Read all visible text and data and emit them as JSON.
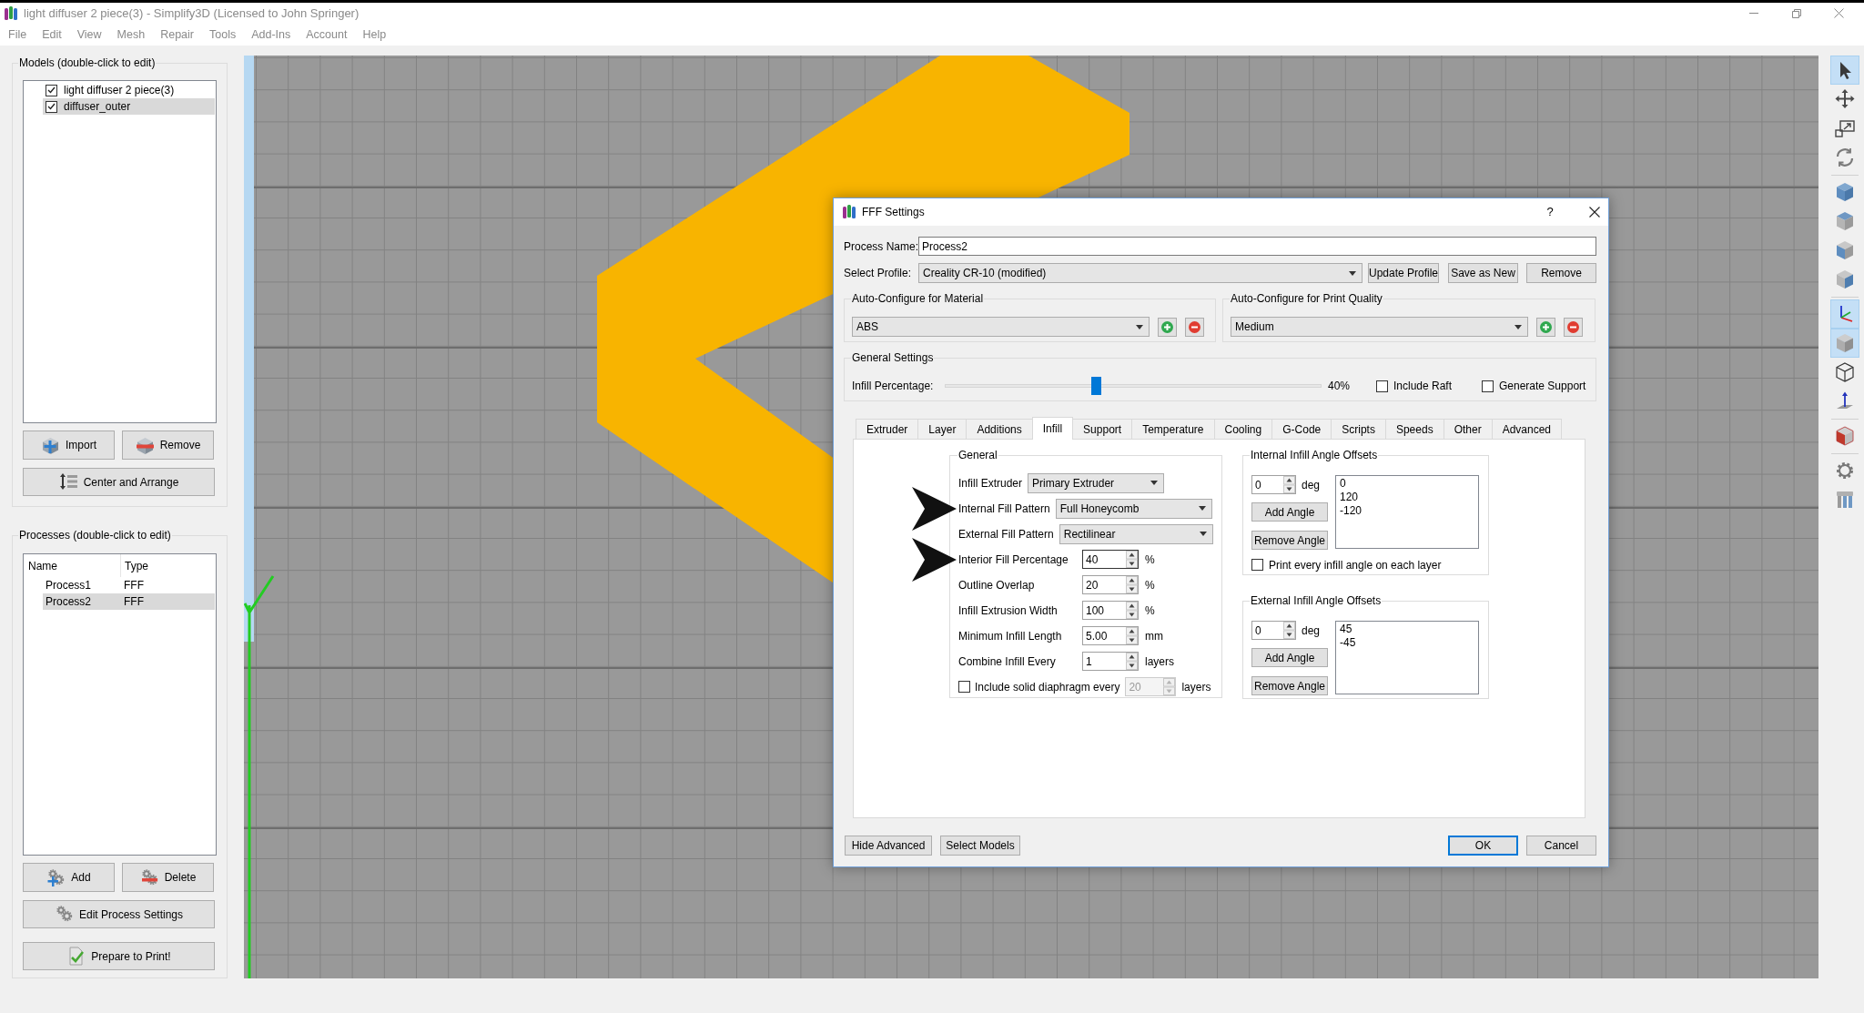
{
  "window": {
    "title": "light diffuser 2 piece(3) - Simplify3D (Licensed to John Springer)"
  },
  "menu": [
    "File",
    "Edit",
    "View",
    "Mesh",
    "Repair",
    "Tools",
    "Add-Ins",
    "Account",
    "Help"
  ],
  "models_panel": {
    "title": "Models (double-click to edit)",
    "items": [
      {
        "name": "light diffuser 2 piece(3)",
        "checked": true,
        "selected": false
      },
      {
        "name": "diffuser_outer",
        "checked": true,
        "selected": true
      }
    ],
    "buttons": [
      "Import",
      "Remove",
      "Center and Arrange"
    ]
  },
  "processes_panel": {
    "title": "Processes (double-click to edit)",
    "columns": [
      "Name",
      "Type"
    ],
    "rows": [
      {
        "name": "Process1",
        "type": "FFF",
        "selected": false
      },
      {
        "name": "Process2",
        "type": "FFF",
        "selected": true
      }
    ],
    "buttons": [
      "Add",
      "Delete",
      "Edit Process Settings",
      "Prepare to Print!"
    ]
  },
  "toolbar": [
    {
      "selected": true
    },
    {
      "selected": false
    },
    {
      "selected": false
    },
    {
      "selected": false
    },
    {
      "selected": false
    },
    {
      "selected": false
    },
    {
      "selected": false
    },
    {
      "selected": false
    },
    {
      "selected": true
    },
    {
      "selected": true
    },
    {
      "selected": false
    },
    {
      "selected": false
    },
    {
      "selected": false
    },
    {
      "selected": false
    },
    {
      "selected": false
    }
  ],
  "dialog": {
    "title": "FFF Settings",
    "help": "?",
    "process_name": {
      "label": "Process Name:",
      "value": "Process2"
    },
    "profile": {
      "label": "Select Profile:",
      "value": "Creality CR-10 (modified)",
      "buttons": [
        "Update Profile",
        "Save as New",
        "Remove"
      ]
    },
    "auto_configure": [
      {
        "title": "Auto-Configure for Material",
        "value": "ABS"
      },
      {
        "title": "Auto-Configure for Print Quality",
        "value": "Medium"
      }
    ],
    "general": {
      "title": "General Settings",
      "infill": {
        "label": "Infill Percentage:",
        "level": 0.4,
        "reading": "40%"
      },
      "checkboxes": [
        {
          "label": "Include Raft",
          "checked": false
        },
        {
          "label": "Generate Support",
          "checked": false
        }
      ]
    },
    "tabs": [
      {
        "label": "Extruder",
        "selected": false
      },
      {
        "label": "Layer",
        "selected": false
      },
      {
        "label": "Additions",
        "selected": false
      },
      {
        "label": "Infill",
        "selected": true
      },
      {
        "label": "Support",
        "selected": false
      },
      {
        "label": "Temperature",
        "selected": false
      },
      {
        "label": "Cooling",
        "selected": false
      },
      {
        "label": "G-Code",
        "selected": false
      },
      {
        "label": "Scripts",
        "selected": false
      },
      {
        "label": "Speeds",
        "selected": false
      },
      {
        "label": "Other",
        "selected": false
      },
      {
        "label": "Advanced",
        "selected": false
      }
    ],
    "tab_panel": {
      "general": {
        "title": "General",
        "fields": [
          {
            "kind": "select",
            "label": "Infill Extruder",
            "value": "Primary Extruder",
            "arrow": false,
            "focused": false
          },
          {
            "kind": "select",
            "label": "Internal Fill Pattern",
            "value": "Full Honeycomb",
            "arrow": true,
            "focused": false
          },
          {
            "kind": "select",
            "label": "External Fill Pattern",
            "value": "Rectilinear",
            "arrow": false,
            "focused": false
          },
          {
            "kind": "spin",
            "label": "Interior Fill Percentage",
            "value": "40",
            "unit": "%",
            "arrow": true,
            "focused": true
          },
          {
            "kind": "spin",
            "label": "Outline Overlap",
            "value": "20",
            "unit": "%",
            "arrow": false,
            "focused": false
          },
          {
            "kind": "spin",
            "label": "Infill Extrusion Width",
            "value": "100",
            "unit": "%",
            "arrow": false,
            "focused": false
          },
          {
            "kind": "spin",
            "label": "Minimum Infill Length",
            "value": "5.00",
            "unit": "mm",
            "arrow": false,
            "focused": false
          },
          {
            "kind": "spin",
            "label": "Combine Infill Every",
            "value": "1",
            "unit": "layers",
            "arrow": false,
            "focused": false
          },
          {
            "kind": "check_spin",
            "label": "Include solid diaphragm every",
            "checked": false,
            "value": "20",
            "unit": "layers",
            "disabled": true,
            "arrow": false,
            "focused": false
          }
        ]
      },
      "angle_groups": [
        {
          "title": "Internal Infill Angle Offsets",
          "spin": "0",
          "unit": "deg",
          "buttons": [
            "Add Angle",
            "Remove Angle"
          ],
          "list": [
            "0",
            "120",
            "-120"
          ],
          "checkbox": {
            "label": "Print every infill angle on each layer",
            "checked": false
          }
        },
        {
          "title": "External Infill Angle Offsets",
          "spin": "0",
          "unit": "deg",
          "buttons": [
            "Add Angle",
            "Remove Angle"
          ],
          "list": [
            "45",
            "-45"
          ]
        }
      ]
    },
    "footer": {
      "left": [
        {
          "label": "Hide Advanced",
          "default": false
        },
        {
          "label": "Select Models",
          "default": false
        }
      ],
      "right": [
        {
          "label": "OK",
          "default": true
        },
        {
          "label": "Cancel",
          "default": false
        }
      ]
    }
  }
}
